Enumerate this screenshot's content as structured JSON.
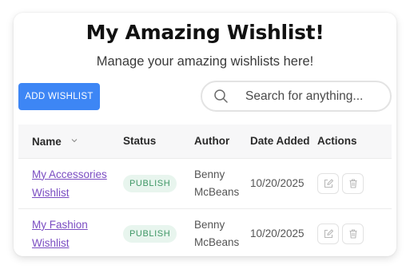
{
  "header": {
    "title": "My Amazing Wishlist!",
    "subtitle": "Manage your amazing wishlists here!"
  },
  "toolbar": {
    "add_label": "ADD WISHLIST",
    "search_placeholder": "Search for anything..."
  },
  "table": {
    "columns": {
      "name": "Name",
      "status": "Status",
      "author": "Author",
      "date": "Date Added",
      "actions": "Actions"
    },
    "rows": [
      {
        "name_line1": "My Accessories",
        "name_line2": "Wishlist",
        "status": "PUBLISH",
        "author_line1": "Benny",
        "author_line2": "McBeans",
        "date": "10/20/2025"
      },
      {
        "name_line1": "My Fashion Wishlist",
        "name_line2": "",
        "status": "PUBLISH",
        "author_line1": "Benny",
        "author_line2": "McBeans",
        "date": "10/20/2025"
      }
    ]
  },
  "colors": {
    "accent": "#3d86f5",
    "link": "#7a4cc2",
    "badge_bg": "#e8f5ee",
    "badge_text": "#3f9766"
  },
  "icons": [
    "search-icon",
    "sort-chevron-icon",
    "edit-icon",
    "trash-icon"
  ]
}
